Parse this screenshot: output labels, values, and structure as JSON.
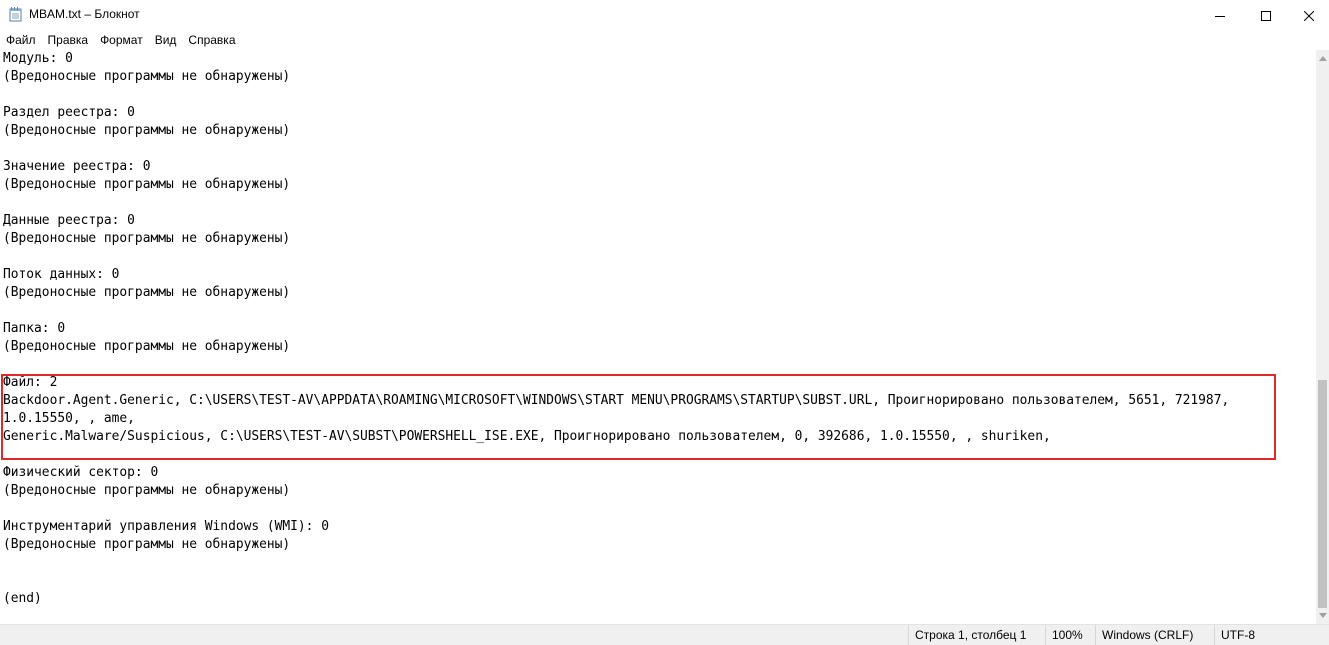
{
  "window": {
    "title": "MBAM.txt – Блокнот"
  },
  "menu": {
    "items": [
      "Файл",
      "Правка",
      "Формат",
      "Вид",
      "Справка"
    ]
  },
  "editor": {
    "lines": [
      "Модуль: 0",
      "(Вредоносные программы не обнаружены)",
      "",
      "Раздел реестра: 0",
      "(Вредоносные программы не обнаружены)",
      "",
      "Значение реестра: 0",
      "(Вредоносные программы не обнаружены)",
      "",
      "Данные реестра: 0",
      "(Вредоносные программы не обнаружены)",
      "",
      "Поток данных: 0",
      "(Вредоносные программы не обнаружены)",
      "",
      "Папка: 0",
      "(Вредоносные программы не обнаружены)",
      "",
      "Файл: 2",
      "Backdoor.Agent.Generic, C:\\USERS\\TEST-AV\\APPDATA\\ROAMING\\MICROSOFT\\WINDOWS\\START MENU\\PROGRAMS\\STARTUP\\SUBST.URL, Проигнорировано пользователем, 5651, 721987,",
      "1.0.15550, , ame,",
      "Generic.Malware/Suspicious, C:\\USERS\\TEST-AV\\SUBST\\POWERSHELL_ISE.EXE, Проигнорировано пользователем, 0, 392686, 1.0.15550, , shuriken,",
      "",
      "Физический сектор: 0",
      "(Вредоносные программы не обнаружены)",
      "",
      "Инструментарий управления Windows (WMI): 0",
      "(Вредоносные программы не обнаружены)",
      "",
      "",
      "(end)"
    ],
    "highlight_color": "#e02a2a"
  },
  "statusbar": {
    "position": "Строка 1, столбец 1",
    "zoom": "100%",
    "line_endings": "Windows (CRLF)",
    "encoding": "UTF-8"
  },
  "icons": {
    "app": "notepad-icon",
    "minimize": "minimize-icon",
    "maximize": "maximize-icon",
    "close": "close-icon"
  }
}
